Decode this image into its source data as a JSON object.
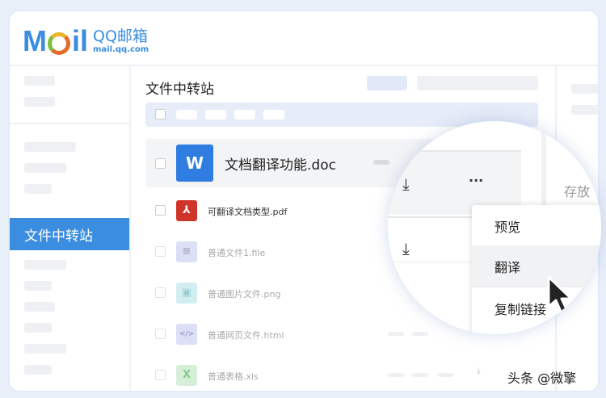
{
  "logo": {
    "brand": "MOIL",
    "name": "QQ邮箱",
    "domain": "mail.qq.com"
  },
  "sidebar": {
    "active_item": "文件中转站"
  },
  "main": {
    "title": "文件中转站",
    "files": [
      {
        "name": "文档翻译功能.doc",
        "icon": "W",
        "color": "#2f7de1"
      },
      {
        "name": "可翻译文档类型.pdf",
        "icon": "pdf",
        "color": "#d0352b"
      },
      {
        "name": "普通文件1.file",
        "icon": "file",
        "color": "#c9cdf2"
      },
      {
        "name": "普通图片文件.png",
        "icon": "image",
        "color": "#bfe3e6"
      },
      {
        "name": "普通网页文件.html",
        "icon": "</>",
        "color": "#c9cdf2"
      },
      {
        "name": "普通表格.xls",
        "icon": "X",
        "color": "#c7e8cc"
      }
    ]
  },
  "right_panel": {
    "label": "存放"
  },
  "context_menu": {
    "items": [
      "预览",
      "翻译",
      "复制链接"
    ],
    "more": "···"
  },
  "watermark": "头条 @微擎"
}
